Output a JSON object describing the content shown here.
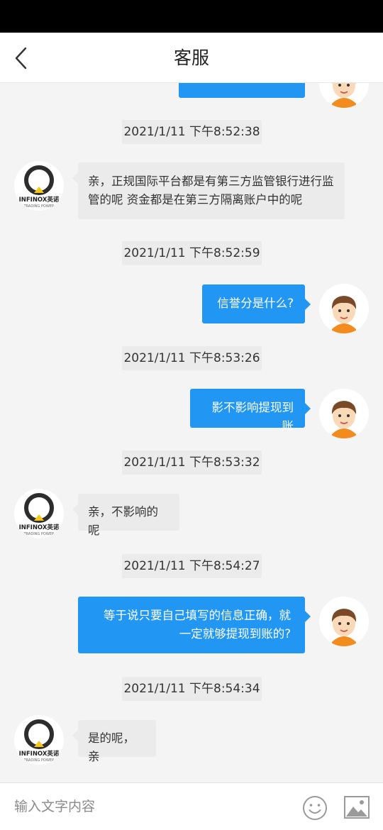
{
  "header": {
    "title": "客服"
  },
  "messages": [
    {
      "time": "2021/1/11 下午8:52:38",
      "text": "亲，正规国际平台都是有第三方监管银行进行监管的呢 资金都是在第三方隔离账户中的呢"
    },
    {
      "time": "2021/1/11 下午8:52:59",
      "text": "信誉分是什么?"
    },
    {
      "time": "2021/1/11 下午8:53:26",
      "text": "影不影响提现到账"
    },
    {
      "time": "2021/1/11 下午8:53:32",
      "text": "亲，不影响的呢"
    },
    {
      "time": "2021/1/11 下午8:54:27",
      "text": "等于说只要自己填写的信息正确，就一定就够提现到账的?"
    },
    {
      "time": "2021/1/11 下午8:54:34",
      "text": "是的呢，亲"
    }
  ],
  "agent_logo": {
    "brand": "INFINOX英诺",
    "tagline": "TRADING POWER"
  },
  "input": {
    "placeholder": "输入文字内容"
  },
  "icons": {
    "back": "chevron-left-icon",
    "emoji": "smiley-icon",
    "image": "image-icon"
  },
  "colors": {
    "accent": "#2196f3",
    "logo_yellow": "#f5c518"
  }
}
